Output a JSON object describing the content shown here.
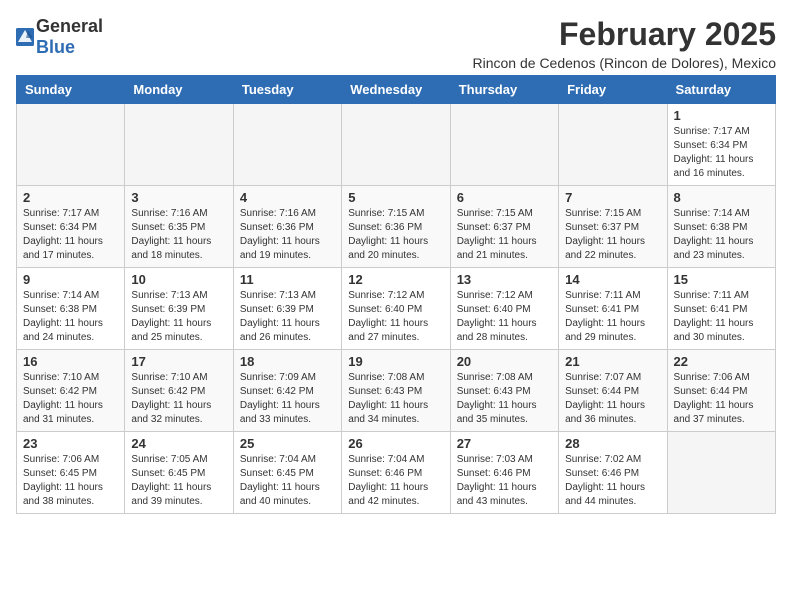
{
  "logo": {
    "general": "General",
    "blue": "Blue"
  },
  "title": "February 2025",
  "subtitle": "Rincon de Cedenos (Rincon de Dolores), Mexico",
  "weekdays": [
    "Sunday",
    "Monday",
    "Tuesday",
    "Wednesday",
    "Thursday",
    "Friday",
    "Saturday"
  ],
  "weeks": [
    [
      {
        "day": "",
        "info": ""
      },
      {
        "day": "",
        "info": ""
      },
      {
        "day": "",
        "info": ""
      },
      {
        "day": "",
        "info": ""
      },
      {
        "day": "",
        "info": ""
      },
      {
        "day": "",
        "info": ""
      },
      {
        "day": "1",
        "info": "Sunrise: 7:17 AM\nSunset: 6:34 PM\nDaylight: 11 hours and 16 minutes."
      }
    ],
    [
      {
        "day": "2",
        "info": "Sunrise: 7:17 AM\nSunset: 6:34 PM\nDaylight: 11 hours and 17 minutes."
      },
      {
        "day": "3",
        "info": "Sunrise: 7:16 AM\nSunset: 6:35 PM\nDaylight: 11 hours and 18 minutes."
      },
      {
        "day": "4",
        "info": "Sunrise: 7:16 AM\nSunset: 6:36 PM\nDaylight: 11 hours and 19 minutes."
      },
      {
        "day": "5",
        "info": "Sunrise: 7:15 AM\nSunset: 6:36 PM\nDaylight: 11 hours and 20 minutes."
      },
      {
        "day": "6",
        "info": "Sunrise: 7:15 AM\nSunset: 6:37 PM\nDaylight: 11 hours and 21 minutes."
      },
      {
        "day": "7",
        "info": "Sunrise: 7:15 AM\nSunset: 6:37 PM\nDaylight: 11 hours and 22 minutes."
      },
      {
        "day": "8",
        "info": "Sunrise: 7:14 AM\nSunset: 6:38 PM\nDaylight: 11 hours and 23 minutes."
      }
    ],
    [
      {
        "day": "9",
        "info": "Sunrise: 7:14 AM\nSunset: 6:38 PM\nDaylight: 11 hours and 24 minutes."
      },
      {
        "day": "10",
        "info": "Sunrise: 7:13 AM\nSunset: 6:39 PM\nDaylight: 11 hours and 25 minutes."
      },
      {
        "day": "11",
        "info": "Sunrise: 7:13 AM\nSunset: 6:39 PM\nDaylight: 11 hours and 26 minutes."
      },
      {
        "day": "12",
        "info": "Sunrise: 7:12 AM\nSunset: 6:40 PM\nDaylight: 11 hours and 27 minutes."
      },
      {
        "day": "13",
        "info": "Sunrise: 7:12 AM\nSunset: 6:40 PM\nDaylight: 11 hours and 28 minutes."
      },
      {
        "day": "14",
        "info": "Sunrise: 7:11 AM\nSunset: 6:41 PM\nDaylight: 11 hours and 29 minutes."
      },
      {
        "day": "15",
        "info": "Sunrise: 7:11 AM\nSunset: 6:41 PM\nDaylight: 11 hours and 30 minutes."
      }
    ],
    [
      {
        "day": "16",
        "info": "Sunrise: 7:10 AM\nSunset: 6:42 PM\nDaylight: 11 hours and 31 minutes."
      },
      {
        "day": "17",
        "info": "Sunrise: 7:10 AM\nSunset: 6:42 PM\nDaylight: 11 hours and 32 minutes."
      },
      {
        "day": "18",
        "info": "Sunrise: 7:09 AM\nSunset: 6:42 PM\nDaylight: 11 hours and 33 minutes."
      },
      {
        "day": "19",
        "info": "Sunrise: 7:08 AM\nSunset: 6:43 PM\nDaylight: 11 hours and 34 minutes."
      },
      {
        "day": "20",
        "info": "Sunrise: 7:08 AM\nSunset: 6:43 PM\nDaylight: 11 hours and 35 minutes."
      },
      {
        "day": "21",
        "info": "Sunrise: 7:07 AM\nSunset: 6:44 PM\nDaylight: 11 hours and 36 minutes."
      },
      {
        "day": "22",
        "info": "Sunrise: 7:06 AM\nSunset: 6:44 PM\nDaylight: 11 hours and 37 minutes."
      }
    ],
    [
      {
        "day": "23",
        "info": "Sunrise: 7:06 AM\nSunset: 6:45 PM\nDaylight: 11 hours and 38 minutes."
      },
      {
        "day": "24",
        "info": "Sunrise: 7:05 AM\nSunset: 6:45 PM\nDaylight: 11 hours and 39 minutes."
      },
      {
        "day": "25",
        "info": "Sunrise: 7:04 AM\nSunset: 6:45 PM\nDaylight: 11 hours and 40 minutes."
      },
      {
        "day": "26",
        "info": "Sunrise: 7:04 AM\nSunset: 6:46 PM\nDaylight: 11 hours and 42 minutes."
      },
      {
        "day": "27",
        "info": "Sunrise: 7:03 AM\nSunset: 6:46 PM\nDaylight: 11 hours and 43 minutes."
      },
      {
        "day": "28",
        "info": "Sunrise: 7:02 AM\nSunset: 6:46 PM\nDaylight: 11 hours and 44 minutes."
      },
      {
        "day": "",
        "info": ""
      }
    ]
  ]
}
